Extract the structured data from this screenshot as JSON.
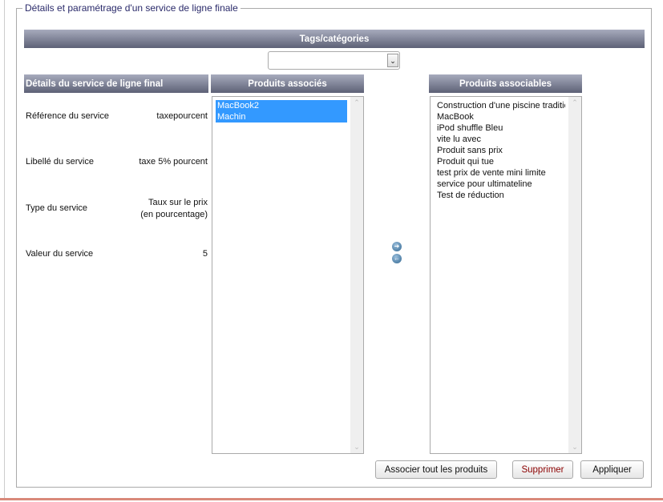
{
  "legend": "Détails et paramétrage d'un service de ligne finale",
  "tags_header": "Tags/catégories",
  "tags_select": "",
  "details_header": "Détails du service de ligne final",
  "details": [
    {
      "label": "Référence du service",
      "value": "taxepourcent"
    },
    {
      "label": "Libellé du service",
      "value": "taxe 5% pourcent"
    },
    {
      "label": "Type du service",
      "value": "Taux sur le prix",
      "value2": "(en pourcentage)"
    },
    {
      "label": "Valeur du service",
      "value": "5"
    }
  ],
  "associated_header": "Produits associés",
  "associated": [
    "MacBook2",
    "Machin"
  ],
  "associable_header": "Produits associables",
  "associable": [
    "Construction d'une piscine traditio",
    "MacBook",
    "iPod shuffle Bleu",
    "vite lu avec",
    "Produit sans prix",
    "Produit qui tue",
    "test prix de vente mini limite",
    "service pour ultimateline",
    "Test de réduction"
  ],
  "buttons": {
    "associate_all": "Associer tout les produits",
    "delete": "Supprimer",
    "apply": "Appliquer"
  },
  "colors": {
    "delete_text": "#8b0000",
    "selection": "#3399ff"
  }
}
